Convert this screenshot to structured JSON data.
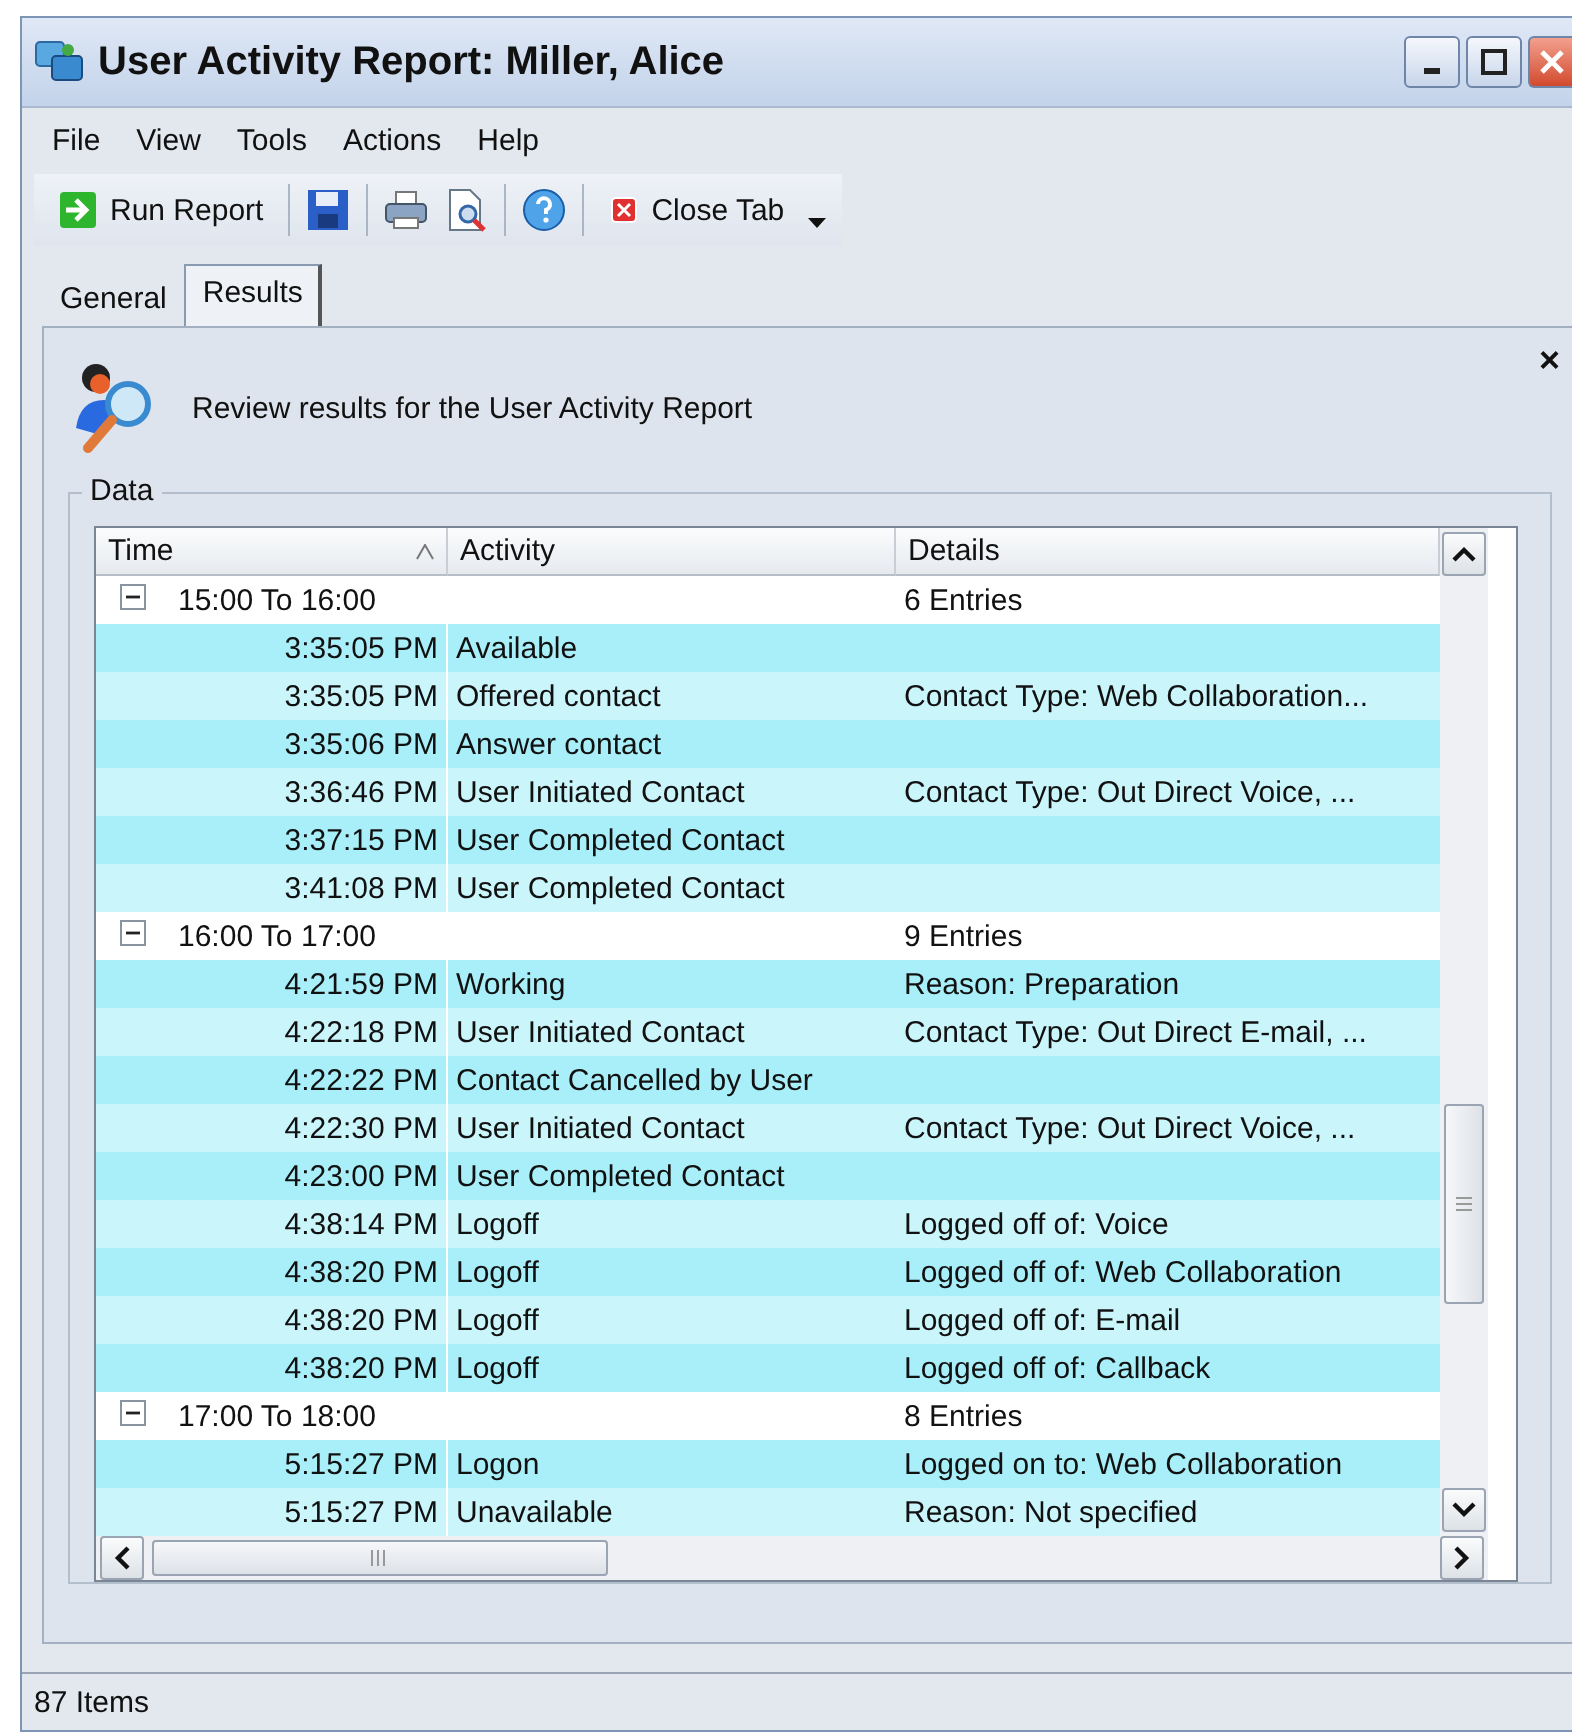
{
  "window": {
    "title": "User Activity Report: Miller, Alice"
  },
  "menu": [
    "File",
    "View",
    "Tools",
    "Actions",
    "Help"
  ],
  "toolbar": {
    "run_label": "Run Report",
    "close_tab_label": "Close Tab"
  },
  "tabs": [
    {
      "label": "General",
      "selected": false
    },
    {
      "label": "Results",
      "selected": true
    }
  ],
  "panel": {
    "description": "Review results for the User Activity Report",
    "close": "×",
    "group_label": "Data"
  },
  "table": {
    "columns": [
      "Time",
      "Activity",
      "Details"
    ],
    "groups": [
      {
        "label": "15:00 To 16:00",
        "count": "6 Entries",
        "expanded": true,
        "children": [
          {
            "time": "3:35:05 PM",
            "activity": "Available"
          },
          {
            "time": "3:35:05 PM",
            "activity": "Offered contact",
            "details": "Contact Type: Web Collaboration..."
          },
          {
            "time": "3:35:06 PM",
            "activity": "Answer contact"
          },
          {
            "time": "3:36:46 PM",
            "activity": "User Initiated Contact",
            "details": "Contact Type: Out Direct Voice, ..."
          },
          {
            "time": "3:37:15 PM",
            "activity": "User Completed Contact"
          },
          {
            "time": "3:41:08 PM",
            "activity": "User Completed Contact"
          }
        ]
      },
      {
        "label": "16:00 To 17:00",
        "count": "9 Entries",
        "expanded": true,
        "children": [
          {
            "time": "4:21:59 PM",
            "activity": "Working",
            "details": "Reason: Preparation"
          },
          {
            "time": "4:22:18 PM",
            "activity": "User Initiated Contact",
            "details": "Contact Type: Out Direct E-mail, ..."
          },
          {
            "time": "4:22:22 PM",
            "activity": "Contact Cancelled by User"
          },
          {
            "time": "4:22:30 PM",
            "activity": "User Initiated Contact",
            "details": "Contact Type: Out Direct Voice, ..."
          },
          {
            "time": "4:23:00 PM",
            "activity": "User Completed Contact"
          },
          {
            "time": "4:38:14 PM",
            "activity": "Logoff",
            "details": "Logged off of: Voice"
          },
          {
            "time": "4:38:20 PM",
            "activity": "Logoff",
            "details": "Logged off of: Web Collaboration"
          },
          {
            "time": "4:38:20 PM",
            "activity": "Logoff",
            "details": "Logged off of: E-mail"
          },
          {
            "time": "4:38:20 PM",
            "activity": "Logoff",
            "details": "Logged off of: Callback"
          }
        ]
      },
      {
        "label": "17:00 To 18:00",
        "count": "8 Entries",
        "expanded": true,
        "children": [
          {
            "time": "5:15:27 PM",
            "activity": "Logon",
            "details": "Logged on to: Web Collaboration"
          },
          {
            "time": "5:15:27 PM",
            "activity": "Unavailable",
            "details": "Reason: Not specified"
          }
        ]
      }
    ]
  },
  "status_bar": "87 Items"
}
